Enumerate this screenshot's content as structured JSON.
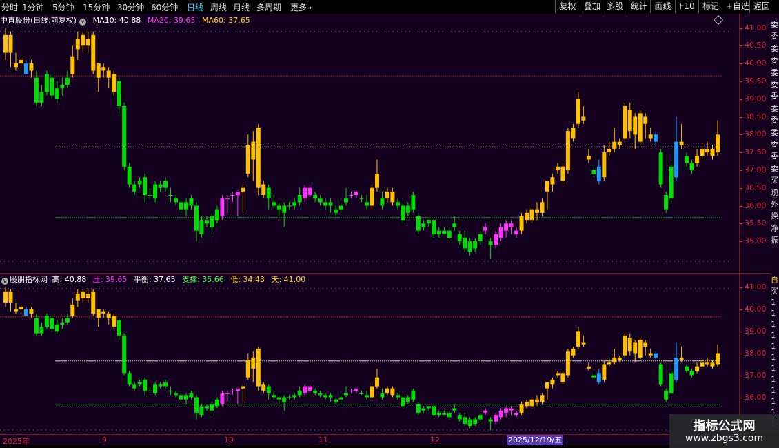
{
  "toolbar": {
    "periods": [
      "分时",
      "1分钟",
      "5分钟",
      "15分钟",
      "30分钟",
      "60分钟",
      "日线",
      "周线",
      "月线",
      "多周期",
      "更多"
    ],
    "active_period": "日线",
    "right_buttons": [
      "复权",
      "叠加",
      "多股",
      "统计",
      "画线",
      "F10",
      "标记",
      "+自选",
      "返回"
    ]
  },
  "main_panel": {
    "title": "中直股份(日线,前复权)",
    "ma": [
      {
        "label": "MA10: 40.88",
        "color": "#ffffff"
      },
      {
        "label": "MA20: 39.65",
        "color": "#ff33ff"
      },
      {
        "label": "MA60: 37.65",
        "color": "#ffd700"
      }
    ],
    "y_ticks": [
      "41.00",
      "40.50",
      "40.00",
      "39.50",
      "39.00",
      "38.50",
      "38.00",
      "37.50",
      "37.00",
      "36.50",
      "36.00",
      "35.50",
      "35.00"
    ],
    "y_values": [
      41.0,
      40.5,
      40.0,
      39.5,
      39.0,
      38.5,
      38.0,
      37.5,
      37.0,
      36.5,
      36.0,
      35.5,
      35.0
    ]
  },
  "indicator_panel": {
    "name": "股朋指标网",
    "values": [
      {
        "label": "高: 40.88",
        "color": "#ffffff"
      },
      {
        "label": "压: 39.65",
        "color": "#ff33ff"
      },
      {
        "label": "平衡: 37.65",
        "color": "#ffffff"
      },
      {
        "label": "支撑: 35.66",
        "color": "#33ff33"
      },
      {
        "label": "低: 34.43",
        "color": "#ffd700"
      },
      {
        "label": "天: 41.00",
        "color": "#ffd700"
      }
    ],
    "y_ticks": [
      "41.00",
      "40.00",
      "39.00",
      "38.00",
      "37.00",
      "36.00"
    ],
    "y_values": [
      41.0,
      40.0,
      39.0,
      38.0,
      37.0,
      36.0
    ]
  },
  "date_axis": {
    "labels": [
      "2025年",
      "9",
      "10",
      "11",
      "12"
    ],
    "cursor": "2025/12/19/五"
  },
  "right_strip": {
    "top_chars": [
      "委",
      "委",
      "委",
      "委",
      "委",
      "委",
      "委",
      "委",
      "委",
      "委",
      "委",
      "委",
      "委",
      "买",
      "现",
      "外",
      "换",
      "净",
      "振"
    ],
    "bottom_chars": [
      "自",
      "买",
      "1",
      "1",
      "1",
      "1",
      "1",
      "1",
      "1",
      "1",
      "1",
      "1",
      "1",
      "1"
    ]
  },
  "watermark": {
    "line1": "指标公式网",
    "line2": "www.zbgs3.com"
  },
  "colors": {
    "up": "#ffc000",
    "down": "#00dd00",
    "magenta": "#ff33ff",
    "blue": "#2299ff",
    "grid_red": "#b01818",
    "axis_text": "#dd2233",
    "panel_bg": "#14001f"
  },
  "chart_data": {
    "type": "candlestick",
    "price_levels": {
      "high": 40.88,
      "pressure": 39.65,
      "balance": 37.65,
      "support": 35.66,
      "low": 34.43,
      "sky": 41.0
    },
    "candles": [
      {
        "o": 40.3,
        "h": 41.0,
        "l": 40.1,
        "c": 40.8,
        "t": "u"
      },
      {
        "o": 40.3,
        "h": 40.9,
        "l": 39.9,
        "c": 40.8,
        "t": "u"
      },
      {
        "o": 40.0,
        "h": 40.3,
        "l": 39.8,
        "c": 39.9,
        "t": "u"
      },
      {
        "o": 40.0,
        "h": 40.2,
        "l": 39.8,
        "c": 40.1,
        "t": "u"
      },
      {
        "o": 40.0,
        "h": 40.1,
        "l": 39.7,
        "c": 39.7,
        "t": "b"
      },
      {
        "o": 39.8,
        "h": 40.1,
        "l": 39.6,
        "c": 40.0,
        "t": "u"
      },
      {
        "o": 39.6,
        "h": 39.8,
        "l": 38.8,
        "c": 38.9,
        "t": "d"
      },
      {
        "o": 38.9,
        "h": 39.4,
        "l": 38.8,
        "c": 39.2,
        "t": "d"
      },
      {
        "o": 39.7,
        "h": 39.8,
        "l": 39.1,
        "c": 39.2,
        "t": "d"
      },
      {
        "o": 39.6,
        "h": 39.7,
        "l": 39.0,
        "c": 39.1,
        "t": "d"
      },
      {
        "o": 39.3,
        "h": 39.5,
        "l": 38.9,
        "c": 39.0,
        "t": "d"
      },
      {
        "o": 39.4,
        "h": 39.6,
        "l": 39.1,
        "c": 39.3,
        "t": "d"
      },
      {
        "o": 39.6,
        "h": 39.8,
        "l": 39.3,
        "c": 39.4,
        "t": "d"
      },
      {
        "o": 40.2,
        "h": 40.5,
        "l": 39.6,
        "c": 39.7,
        "t": "u"
      },
      {
        "o": 40.4,
        "h": 40.9,
        "l": 40.1,
        "c": 40.7,
        "t": "u"
      },
      {
        "o": 40.5,
        "h": 40.9,
        "l": 40.3,
        "c": 40.8,
        "t": "u"
      },
      {
        "o": 40.5,
        "h": 40.9,
        "l": 40.3,
        "c": 40.7,
        "t": "u"
      },
      {
        "o": 39.8,
        "h": 40.9,
        "l": 39.7,
        "c": 40.8,
        "t": "u"
      },
      {
        "o": 39.6,
        "h": 40.0,
        "l": 39.2,
        "c": 40.0,
        "t": "u"
      },
      {
        "o": 39.8,
        "h": 40.0,
        "l": 39.6,
        "c": 39.9,
        "t": "u"
      },
      {
        "o": 39.6,
        "h": 39.9,
        "l": 39.3,
        "c": 39.8,
        "t": "u"
      },
      {
        "o": 39.2,
        "h": 39.8,
        "l": 39.1,
        "c": 39.7,
        "t": "u"
      },
      {
        "o": 39.5,
        "h": 39.6,
        "l": 38.6,
        "c": 38.8,
        "t": "d"
      },
      {
        "o": 38.8,
        "h": 38.9,
        "l": 37.0,
        "c": 37.1,
        "t": "d"
      },
      {
        "o": 37.1,
        "h": 37.2,
        "l": 36.5,
        "c": 36.6,
        "t": "d"
      },
      {
        "o": 36.6,
        "h": 36.7,
        "l": 36.3,
        "c": 36.4,
        "t": "d"
      },
      {
        "o": 36.7,
        "h": 36.8,
        "l": 36.5,
        "c": 36.6,
        "t": "d"
      },
      {
        "o": 36.8,
        "h": 36.9,
        "l": 36.1,
        "c": 36.3,
        "t": "d"
      },
      {
        "o": 36.3,
        "h": 36.5,
        "l": 36.2,
        "c": 36.3,
        "t": "d"
      },
      {
        "o": 36.6,
        "h": 36.7,
        "l": 36.1,
        "c": 36.2,
        "t": "d"
      },
      {
        "o": 36.5,
        "h": 36.7,
        "l": 36.4,
        "c": 36.6,
        "t": "d"
      },
      {
        "o": 36.7,
        "h": 36.8,
        "l": 36.4,
        "c": 36.5,
        "t": "d"
      },
      {
        "o": 36.3,
        "h": 36.5,
        "l": 36.1,
        "c": 36.3,
        "t": "d"
      },
      {
        "o": 36.2,
        "h": 36.3,
        "l": 36.0,
        "c": 36.1,
        "t": "d"
      },
      {
        "o": 36.1,
        "h": 36.2,
        "l": 35.8,
        "c": 35.9,
        "t": "d"
      },
      {
        "o": 35.9,
        "h": 36.2,
        "l": 35.7,
        "c": 36.1,
        "t": "d"
      },
      {
        "o": 36.2,
        "h": 36.3,
        "l": 35.9,
        "c": 36.0,
        "t": "d"
      },
      {
        "o": 36.0,
        "h": 36.1,
        "l": 35.0,
        "c": 35.3,
        "t": "d"
      },
      {
        "o": 35.6,
        "h": 35.7,
        "l": 35.1,
        "c": 35.2,
        "t": "d"
      },
      {
        "o": 35.6,
        "h": 35.7,
        "l": 35.4,
        "c": 35.5,
        "t": "d"
      },
      {
        "o": 35.7,
        "h": 35.8,
        "l": 35.2,
        "c": 35.4,
        "t": "d"
      },
      {
        "o": 35.9,
        "h": 36.0,
        "l": 35.5,
        "c": 35.6,
        "t": "d"
      },
      {
        "o": 35.7,
        "h": 36.3,
        "l": 35.6,
        "c": 36.2,
        "t": "m"
      },
      {
        "o": 36.2,
        "h": 36.3,
        "l": 35.8,
        "c": 36.2,
        "t": "m"
      },
      {
        "o": 36.3,
        "h": 36.4,
        "l": 36.1,
        "c": 36.3,
        "t": "m"
      },
      {
        "o": 36.3,
        "h": 36.4,
        "l": 35.7,
        "c": 36.4,
        "t": "m"
      },
      {
        "o": 36.4,
        "h": 36.6,
        "l": 35.8,
        "c": 36.5,
        "t": "u"
      },
      {
        "o": 36.9,
        "h": 38.0,
        "l": 36.8,
        "c": 37.7,
        "t": "u"
      },
      {
        "o": 37.3,
        "h": 38.1,
        "l": 36.7,
        "c": 37.8,
        "t": "u"
      },
      {
        "o": 36.5,
        "h": 38.3,
        "l": 36.3,
        "c": 38.2,
        "t": "u"
      },
      {
        "o": 36.3,
        "h": 36.7,
        "l": 36.2,
        "c": 36.6,
        "t": "u"
      },
      {
        "o": 36.5,
        "h": 36.6,
        "l": 35.9,
        "c": 36.2,
        "t": "d"
      },
      {
        "o": 36.1,
        "h": 36.3,
        "l": 35.9,
        "c": 36.0,
        "t": "d"
      },
      {
        "o": 36.0,
        "h": 36.1,
        "l": 35.7,
        "c": 35.9,
        "t": "d"
      },
      {
        "o": 36.0,
        "h": 36.1,
        "l": 35.4,
        "c": 35.8,
        "t": "d"
      },
      {
        "o": 36.0,
        "h": 36.1,
        "l": 35.9,
        "c": 36.0,
        "t": "d"
      },
      {
        "o": 36.0,
        "h": 36.2,
        "l": 35.9,
        "c": 36.1,
        "t": "d"
      },
      {
        "o": 36.1,
        "h": 36.5,
        "l": 36.0,
        "c": 36.3,
        "t": "d"
      },
      {
        "o": 36.2,
        "h": 36.6,
        "l": 36.1,
        "c": 36.5,
        "t": "m"
      },
      {
        "o": 36.5,
        "h": 36.6,
        "l": 36.2,
        "c": 36.3,
        "t": "m"
      },
      {
        "o": 36.3,
        "h": 36.4,
        "l": 36.1,
        "c": 36.2,
        "t": "d"
      },
      {
        "o": 36.2,
        "h": 36.3,
        "l": 36.0,
        "c": 36.1,
        "t": "d"
      },
      {
        "o": 36.1,
        "h": 36.2,
        "l": 35.9,
        "c": 36.0,
        "t": "d"
      },
      {
        "o": 36.1,
        "h": 36.2,
        "l": 35.8,
        "c": 36.0,
        "t": "d"
      },
      {
        "o": 35.9,
        "h": 36.0,
        "l": 35.7,
        "c": 35.8,
        "t": "d"
      },
      {
        "o": 35.9,
        "h": 36.1,
        "l": 35.8,
        "c": 36.0,
        "t": "d"
      },
      {
        "o": 36.2,
        "h": 36.5,
        "l": 36.0,
        "c": 36.1,
        "t": "d"
      },
      {
        "o": 36.3,
        "h": 36.4,
        "l": 36.2,
        "c": 36.3,
        "t": "m"
      },
      {
        "o": 36.3,
        "h": 36.4,
        "l": 36.2,
        "c": 36.4,
        "t": "m"
      },
      {
        "o": 36.2,
        "h": 36.3,
        "l": 36.1,
        "c": 36.2,
        "t": "d"
      },
      {
        "o": 36.0,
        "h": 36.3,
        "l": 35.9,
        "c": 36.1,
        "t": "d"
      },
      {
        "o": 36.0,
        "h": 36.6,
        "l": 35.9,
        "c": 36.5,
        "t": "u"
      },
      {
        "o": 36.5,
        "h": 37.3,
        "l": 36.4,
        "c": 36.9,
        "t": "u"
      },
      {
        "o": 36.0,
        "h": 36.4,
        "l": 35.9,
        "c": 36.2,
        "t": "d"
      },
      {
        "o": 36.2,
        "h": 36.5,
        "l": 36.1,
        "c": 36.4,
        "t": "u"
      },
      {
        "o": 36.1,
        "h": 36.5,
        "l": 36.0,
        "c": 36.4,
        "t": "u"
      },
      {
        "o": 36.1,
        "h": 36.2,
        "l": 35.9,
        "c": 36.0,
        "t": "d"
      },
      {
        "o": 36.0,
        "h": 36.1,
        "l": 35.5,
        "c": 35.6,
        "t": "d"
      },
      {
        "o": 36.0,
        "h": 36.1,
        "l": 35.7,
        "c": 35.8,
        "t": "d"
      },
      {
        "o": 36.3,
        "h": 36.4,
        "l": 35.8,
        "c": 35.9,
        "t": "d"
      },
      {
        "o": 35.7,
        "h": 35.8,
        "l": 35.2,
        "c": 35.3,
        "t": "d"
      },
      {
        "o": 35.5,
        "h": 35.6,
        "l": 35.3,
        "c": 35.4,
        "t": "d"
      },
      {
        "o": 35.6,
        "h": 35.6,
        "l": 35.4,
        "c": 35.5,
        "t": "d"
      },
      {
        "o": 35.6,
        "h": 35.6,
        "l": 35.1,
        "c": 35.2,
        "t": "d"
      },
      {
        "o": 35.3,
        "h": 35.4,
        "l": 35.1,
        "c": 35.2,
        "t": "d"
      },
      {
        "o": 35.2,
        "h": 35.4,
        "l": 35.2,
        "c": 35.3,
        "t": "d"
      },
      {
        "o": 35.3,
        "h": 35.4,
        "l": 35.0,
        "c": 35.1,
        "t": "d"
      },
      {
        "o": 35.5,
        "h": 35.7,
        "l": 35.3,
        "c": 35.4,
        "t": "d"
      },
      {
        "o": 35.2,
        "h": 35.3,
        "l": 34.9,
        "c": 35.0,
        "t": "d"
      },
      {
        "o": 35.1,
        "h": 35.3,
        "l": 34.7,
        "c": 34.8,
        "t": "d"
      },
      {
        "o": 35.0,
        "h": 35.1,
        "l": 34.6,
        "c": 34.7,
        "t": "d"
      },
      {
        "o": 35.0,
        "h": 35.1,
        "l": 34.7,
        "c": 34.8,
        "t": "d"
      },
      {
        "o": 35.2,
        "h": 35.3,
        "l": 34.9,
        "c": 35.0,
        "t": "d"
      },
      {
        "o": 35.3,
        "h": 35.5,
        "l": 35.2,
        "c": 35.4,
        "t": "m"
      },
      {
        "o": 35.0,
        "h": 35.1,
        "l": 34.5,
        "c": 34.9,
        "t": "d"
      },
      {
        "o": 34.9,
        "h": 35.3,
        "l": 34.8,
        "c": 35.2,
        "t": "m"
      },
      {
        "o": 35.1,
        "h": 35.5,
        "l": 35.0,
        "c": 35.4,
        "t": "m"
      },
      {
        "o": 35.5,
        "h": 35.6,
        "l": 35.1,
        "c": 35.3,
        "t": "m"
      },
      {
        "o": 35.4,
        "h": 35.6,
        "l": 35.2,
        "c": 35.5,
        "t": "m"
      },
      {
        "o": 35.2,
        "h": 35.4,
        "l": 35.1,
        "c": 35.3,
        "t": "m"
      },
      {
        "o": 35.3,
        "h": 35.8,
        "l": 35.2,
        "c": 35.7,
        "t": "u"
      },
      {
        "o": 35.6,
        "h": 35.9,
        "l": 35.5,
        "c": 35.8,
        "t": "u"
      },
      {
        "o": 35.6,
        "h": 36.0,
        "l": 35.5,
        "c": 35.9,
        "t": "u"
      },
      {
        "o": 35.8,
        "h": 36.1,
        "l": 35.6,
        "c": 35.9,
        "t": "u"
      },
      {
        "o": 35.8,
        "h": 36.2,
        "l": 35.7,
        "c": 36.1,
        "t": "u"
      },
      {
        "o": 36.4,
        "h": 36.6,
        "l": 35.9,
        "c": 36.7,
        "t": "u"
      },
      {
        "o": 36.6,
        "h": 36.9,
        "l": 36.4,
        "c": 36.8,
        "t": "u"
      },
      {
        "o": 37.0,
        "h": 37.2,
        "l": 36.9,
        "c": 37.1,
        "t": "u"
      },
      {
        "o": 36.7,
        "h": 37.2,
        "l": 36.6,
        "c": 37.1,
        "t": "u"
      },
      {
        "o": 37.0,
        "h": 38.2,
        "l": 36.9,
        "c": 38.1,
        "t": "u"
      },
      {
        "o": 37.9,
        "h": 38.3,
        "l": 37.8,
        "c": 38.2,
        "t": "u"
      },
      {
        "o": 38.3,
        "h": 39.2,
        "l": 38.2,
        "c": 39.0,
        "t": "u"
      },
      {
        "o": 38.4,
        "h": 38.8,
        "l": 38.3,
        "c": 38.5,
        "t": "u"
      },
      {
        "o": 37.4,
        "h": 37.6,
        "l": 37.2,
        "c": 37.3,
        "t": "u"
      },
      {
        "o": 37.0,
        "h": 37.1,
        "l": 36.8,
        "c": 36.9,
        "t": "d"
      },
      {
        "o": 36.7,
        "h": 37.3,
        "l": 36.6,
        "c": 37.1,
        "t": "b"
      },
      {
        "o": 36.8,
        "h": 37.7,
        "l": 36.7,
        "c": 37.5,
        "t": "u"
      },
      {
        "o": 37.5,
        "h": 37.8,
        "l": 37.4,
        "c": 37.6,
        "t": "u"
      },
      {
        "o": 37.6,
        "h": 38.2,
        "l": 37.5,
        "c": 37.8,
        "t": "u"
      },
      {
        "o": 37.7,
        "h": 37.9,
        "l": 37.6,
        "c": 37.8,
        "t": "u"
      },
      {
        "o": 37.9,
        "h": 38.9,
        "l": 37.8,
        "c": 38.8,
        "t": "u"
      },
      {
        "o": 38.7,
        "h": 38.9,
        "l": 37.9,
        "c": 38.1,
        "t": "u"
      },
      {
        "o": 38.0,
        "h": 38.6,
        "l": 37.6,
        "c": 38.5,
        "t": "u"
      },
      {
        "o": 37.8,
        "h": 38.7,
        "l": 37.7,
        "c": 38.6,
        "t": "u"
      },
      {
        "o": 38.3,
        "h": 38.6,
        "l": 37.9,
        "c": 38.5,
        "t": "u"
      },
      {
        "o": 37.9,
        "h": 38.2,
        "l": 37.8,
        "c": 38.0,
        "t": "u"
      },
      {
        "o": 38.0,
        "h": 38.1,
        "l": 37.7,
        "c": 37.8,
        "t": "b"
      },
      {
        "o": 37.5,
        "h": 37.6,
        "l": 36.5,
        "c": 36.6,
        "t": "d"
      },
      {
        "o": 36.3,
        "h": 36.4,
        "l": 35.8,
        "c": 35.9,
        "t": "d"
      },
      {
        "o": 36.2,
        "h": 37.2,
        "l": 36.1,
        "c": 37.1,
        "t": "d"
      },
      {
        "o": 36.8,
        "h": 38.5,
        "l": 36.7,
        "c": 37.8,
        "t": "b"
      },
      {
        "o": 37.7,
        "h": 38.3,
        "l": 37.6,
        "c": 37.8,
        "t": "u"
      },
      {
        "o": 37.4,
        "h": 37.5,
        "l": 37.1,
        "c": 37.2,
        "t": "d"
      },
      {
        "o": 37.0,
        "h": 37.3,
        "l": 36.9,
        "c": 37.2,
        "t": "d"
      },
      {
        "o": 37.2,
        "h": 37.6,
        "l": 37.1,
        "c": 37.4,
        "t": "u"
      },
      {
        "o": 37.4,
        "h": 37.7,
        "l": 37.3,
        "c": 37.6,
        "t": "u"
      },
      {
        "o": 37.5,
        "h": 37.8,
        "l": 37.4,
        "c": 37.6,
        "t": "u"
      },
      {
        "o": 37.6,
        "h": 37.7,
        "l": 37.3,
        "c": 37.4,
        "t": "u"
      },
      {
        "o": 37.5,
        "h": 38.4,
        "l": 37.4,
        "c": 38.0,
        "t": "u"
      }
    ]
  }
}
